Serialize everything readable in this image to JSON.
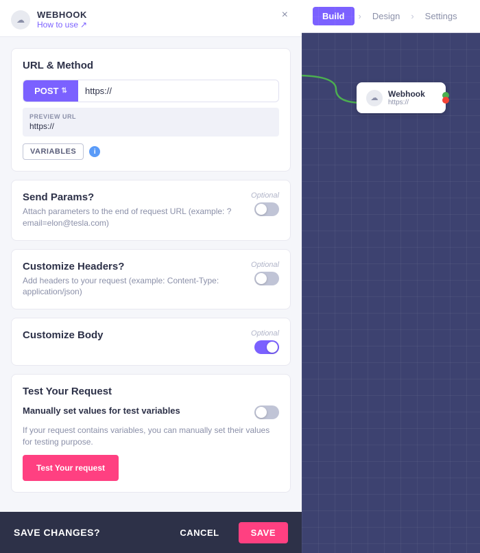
{
  "header": {
    "icon": "☁",
    "title": "WEBHOOK",
    "how_to_use": "How to use",
    "external_link": "↗",
    "close": "×"
  },
  "top_nav": {
    "tabs": [
      {
        "label": "Build",
        "active": true
      },
      {
        "label": "Design",
        "active": false
      },
      {
        "label": "Settings",
        "active": false
      }
    ],
    "chevron": "›"
  },
  "url_method": {
    "title": "URL & Method",
    "method": "POST",
    "url_placeholder": "https://",
    "url_value": "https://",
    "preview_label": "PREVIEW URL",
    "preview_value": "https://",
    "variables_btn": "VARIABLES",
    "info": "i"
  },
  "send_params": {
    "title": "Send Params?",
    "optional": "Optional",
    "description": "Attach parameters to the end of request URL (example: ?email=elon@tesla.com)",
    "enabled": false
  },
  "customize_headers": {
    "title": "Customize Headers?",
    "optional": "Optional",
    "description": "Add headers to your request (example: Content-Type: application/json)",
    "enabled": false
  },
  "customize_body": {
    "title": "Customize Body",
    "optional": "Optional",
    "enabled": true
  },
  "test_request": {
    "title": "Test Your Request",
    "toggle_label": "Manually set values for test variables",
    "description": "If your request contains variables, you can manually set their values for testing purpose.",
    "enabled": false,
    "btn_label": "Test Your request"
  },
  "bottom_bar": {
    "save_changes_label": "SAVE CHANGES?",
    "cancel_label": "CANCEL",
    "save_label": "SAVE"
  },
  "node": {
    "title": "Webhook",
    "url": "https://"
  }
}
